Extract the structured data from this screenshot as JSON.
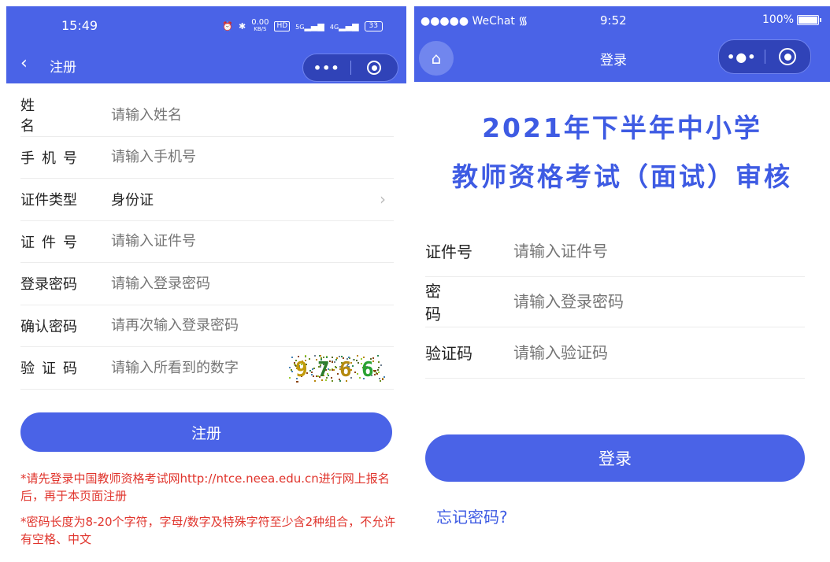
{
  "left": {
    "status_bar": {
      "time": "15:49",
      "icons": [
        "alarm-icon",
        "bluetooth-icon",
        "data-speed",
        "hd-icon",
        "5g-signal-icon",
        "4g-signal-icon",
        "battery-icon"
      ],
      "data_speed": "0.00",
      "data_speed_unit": "KB/S",
      "hd_label": "HD",
      "signal1": "5G",
      "signal2": "4G",
      "battery": "33"
    },
    "nav": {
      "back_icon": "chevron-left-icon",
      "title": "注册",
      "more_icon": "more-dots-icon",
      "record_icon": "record-icon"
    },
    "form": {
      "rows": [
        {
          "label": "姓 名",
          "placeholder": "请输入姓名"
        },
        {
          "label": "手机号",
          "placeholder": "请输入手机号"
        },
        {
          "label": "证件类型",
          "value": "身份证"
        },
        {
          "label": "证件号",
          "placeholder": "请输入证件号"
        },
        {
          "label": "登录密码",
          "placeholder": "请输入登录密码"
        },
        {
          "label": "确认密码",
          "placeholder": "请再次输入登录密码"
        },
        {
          "label": "验证码",
          "placeholder": "请输入所看到的数字"
        }
      ],
      "captcha_digits": [
        "9",
        "7",
        "6",
        "6"
      ],
      "captcha_colors": [
        "#c19a0a",
        "#2c7d2c",
        "#b58a10",
        "#2aa233"
      ]
    },
    "submit_label": "注册",
    "notes": [
      "*请先登录中国教师资格考试网http://ntce.neea.edu.cn进行网上报名后，再于本页面注册",
      "*密码长度为8-20个字符，字母/数字及特殊字符至少含2种组合，不允许有空格、中文"
    ],
    "colors": {
      "accent": "#4a63e7",
      "note": "#e0342c"
    }
  },
  "right": {
    "status_bar": {
      "carrier": "●●●●● WeChat",
      "wifi_icon": "wifi-icon",
      "time": "9:52",
      "battery": "100%"
    },
    "nav": {
      "home_icon": "home-icon",
      "title": "登录",
      "more_icon": "more-dots-icon",
      "record_icon": "record-icon"
    },
    "headline": [
      "2021年下半年中小学",
      "教师资格考试（面试）审核"
    ],
    "form": {
      "rows": [
        {
          "label": "证件号",
          "placeholder": "请输入证件号"
        },
        {
          "label": "密 码",
          "placeholder": "请输入登录密码"
        },
        {
          "label": "验证码",
          "placeholder": "请输入验证码"
        }
      ]
    },
    "login_label": "登录",
    "forgot_label": "忘记密码?",
    "colors": {
      "accent": "#4a63e7",
      "headline": "#3e5be3"
    }
  }
}
